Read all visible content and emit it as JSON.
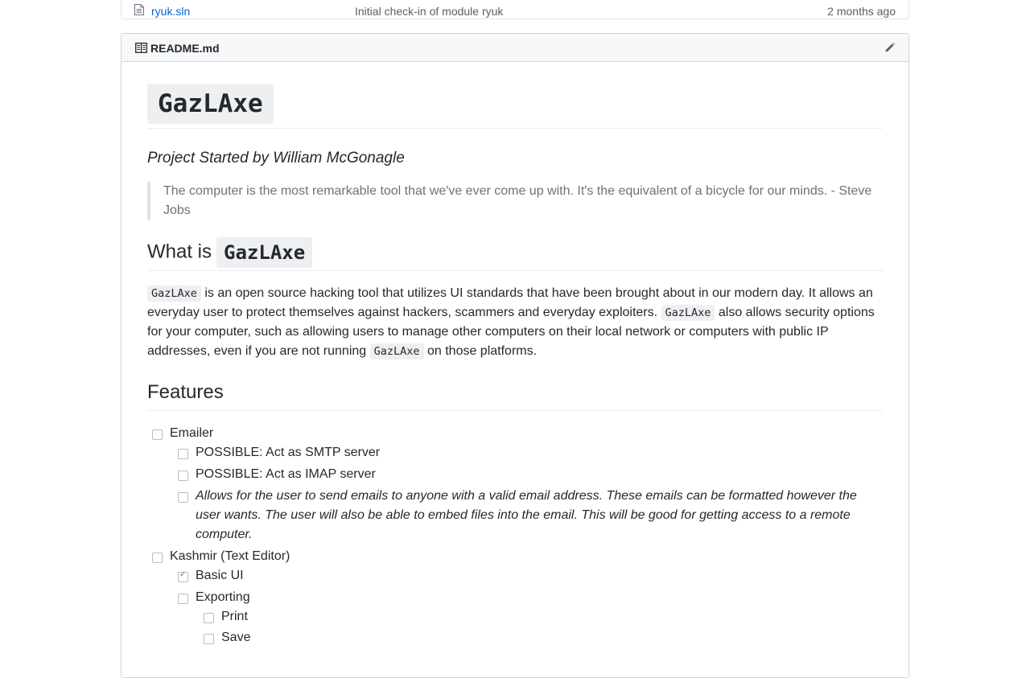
{
  "file_list": {
    "file_name": "ryuk.sln",
    "commit_message": "Initial check-in of module ryuk",
    "age": "2 months ago",
    "file_icon": "file-icon"
  },
  "readme": {
    "title": "README.md",
    "book_icon": "book-icon",
    "edit_icon": "pencil-icon",
    "h1": "GazLAxe",
    "subtitle": "Project Started by William McGonagle",
    "quote": "The computer is the most remarkable tool that we've ever come up with. It's the equivalent of a bicycle for our minds. - Steve Jobs",
    "what_is_prefix": "What is",
    "what_is_code": "GazLAxe",
    "description": {
      "code1": "GazLAxe",
      "text1": " is an open source hacking tool that utilizes UI standards that have been brought about in our modern day. It allows an everyday user to protect themselves against hackers, scammers and everyday exploiters. ",
      "code2": "GazLAxe",
      "text2": " also allows security options for your computer, such as allowing users to manage other computers on their local network or computers with public IP addresses, even if you are not running ",
      "code3": "GazLAxe",
      "text3": " on those platforms."
    },
    "features_heading": "Features",
    "features": [
      {
        "label": "Emailer",
        "checked": false
      },
      {
        "label": "POSSIBLE: Act as SMTP server",
        "checked": false
      },
      {
        "label": "POSSIBLE: Act as IMAP server",
        "checked": false
      },
      {
        "label": "Allows for the user to send emails to anyone with a valid email address. These emails can be formatted however the user wants. The user will also be able to embed files into the email. This will be good for getting access to a remote computer.",
        "checked": false
      },
      {
        "label": "Kashmir (Text Editor)",
        "checked": false
      },
      {
        "label": "Basic UI",
        "checked": true
      },
      {
        "label": "Exporting",
        "checked": false
      },
      {
        "label": "Print",
        "checked": false
      },
      {
        "label": "Save",
        "checked": false
      }
    ]
  }
}
